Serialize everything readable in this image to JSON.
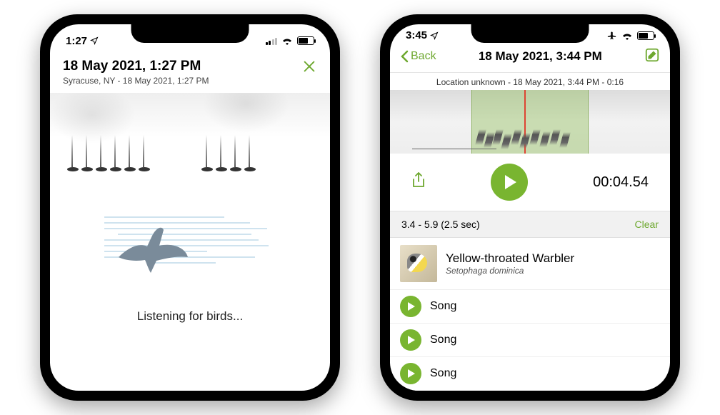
{
  "left": {
    "status_time": "1:27",
    "header_title": "18 May 2021, 1:27 PM",
    "header_subtitle": "Syracuse, NY - 18 May 2021, 1:27 PM",
    "listening_text": "Listening for birds..."
  },
  "right": {
    "status_time": "3:45",
    "back_label": "Back",
    "nav_title": "18 May 2021, 3:44 PM",
    "meta_line": "Location unknown - 18 May 2021, 3:44 PM - 0:16",
    "timecode": "00:04.54",
    "selection_range": "3.4 - 5.9 (2.5 sec)",
    "clear_label": "Clear",
    "species_common": "Yellow-throated Warbler",
    "species_scientific": "Setophaga dominica",
    "song_items": [
      "Song",
      "Song",
      "Song"
    ]
  },
  "colors": {
    "accent": "#79b530",
    "accent_text": "#6ea82f"
  }
}
